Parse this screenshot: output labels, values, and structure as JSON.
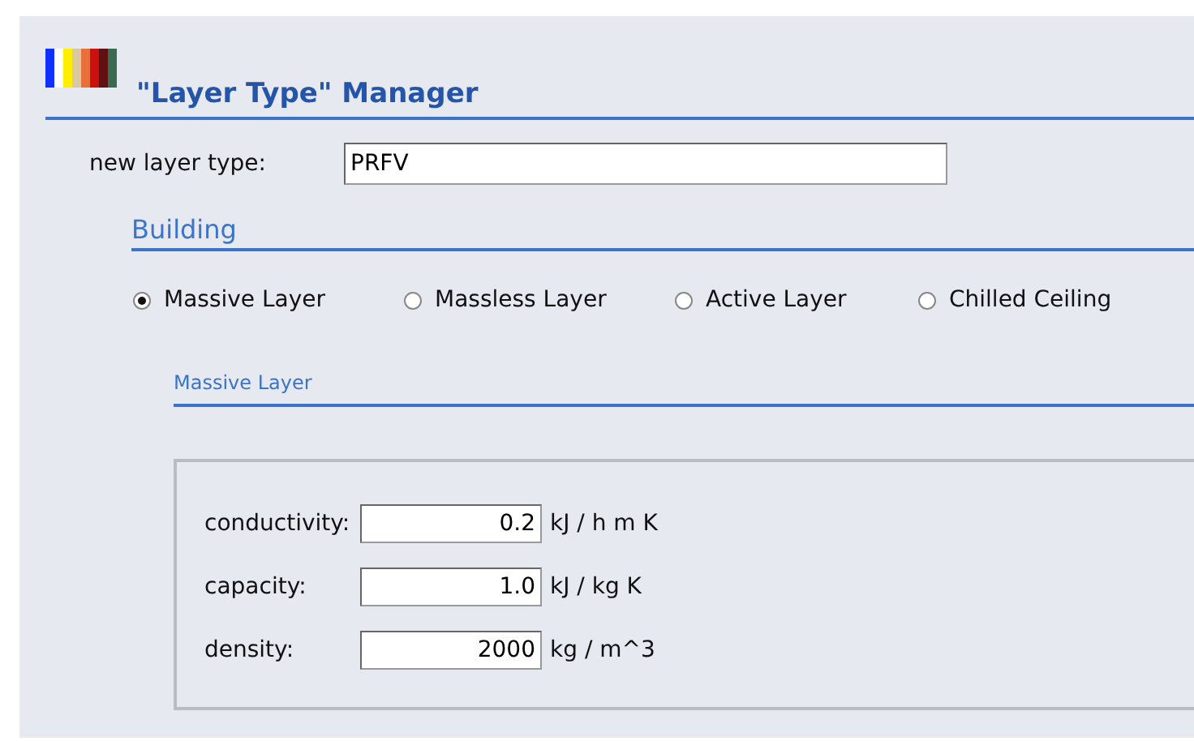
{
  "header": {
    "title": "\"Layer Type\" Manager"
  },
  "new_layer_type": {
    "label": "new layer type:",
    "value": "PRFV"
  },
  "section": {
    "title": "Building"
  },
  "layer_kinds": [
    {
      "label": "Massive Layer",
      "selected": true
    },
    {
      "label": "Massless Layer",
      "selected": false
    },
    {
      "label": "Active Layer",
      "selected": false
    },
    {
      "label": "Chilled Ceiling",
      "selected": false
    }
  ],
  "subsection": {
    "title": "Massive Layer"
  },
  "properties": [
    {
      "label": "conductivity:",
      "value": "0.2",
      "unit": "kJ / h m K"
    },
    {
      "label": "capacity:",
      "value": "1.0",
      "unit": "kJ / kg K"
    },
    {
      "label": "density:",
      "value": "2000",
      "unit": "kg / m^3"
    }
  ]
}
